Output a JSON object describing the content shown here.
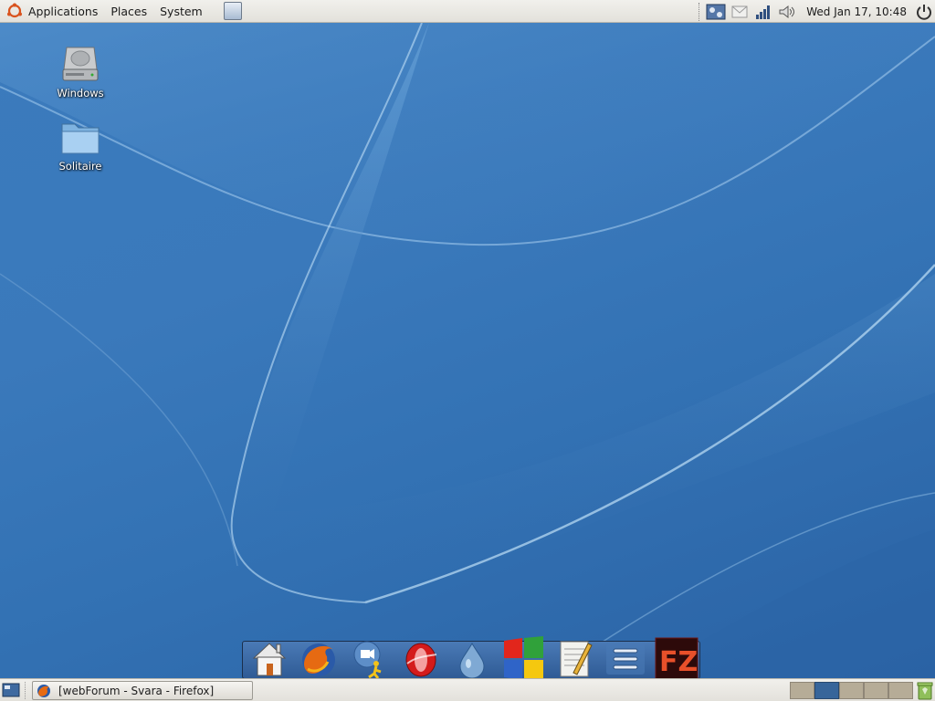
{
  "top_panel": {
    "menus": [
      "Applications",
      "Places",
      "System"
    ],
    "clock": "Wed Jan 17, 10:48",
    "tray_icons": [
      "network-settings-icon",
      "mail-icon",
      "signal-strength-icon",
      "volume-icon",
      "power-icon"
    ]
  },
  "desktop": {
    "icons": [
      {
        "label": "Windows",
        "icon": "hard-drive-icon"
      },
      {
        "label": "Solitaire",
        "icon": "folder-icon"
      }
    ]
  },
  "dock": {
    "items": [
      "home-icon",
      "firefox-icon",
      "messenger-icon",
      "opera-icon",
      "drop-icon",
      "windows-logo-icon",
      "notepad-icon",
      "menu-list-icon",
      "filezilla-icon"
    ]
  },
  "bottom_panel": {
    "tasks": [
      {
        "label": "[webForum - Svara - Firefox]"
      }
    ],
    "workspaces": {
      "count": 6,
      "active": 1
    }
  },
  "colors": {
    "wallpaper": "#3a79bb",
    "panel": "#e8e6e0",
    "active_workspace": "#37659a",
    "inactive_workspace": "#b6ac97"
  }
}
